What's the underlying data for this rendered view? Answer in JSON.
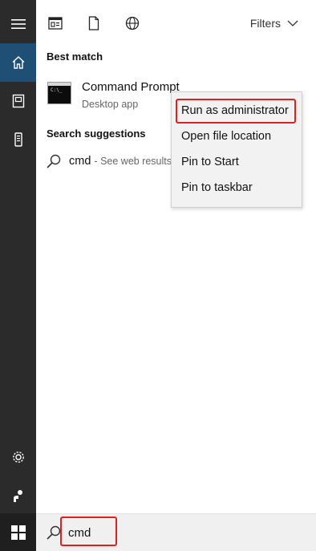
{
  "topbar": {
    "tabs": [
      {
        "icon": "apps-icon"
      },
      {
        "icon": "document-icon"
      },
      {
        "icon": "web-globe-icon"
      }
    ],
    "filters_label": "Filters"
  },
  "sidebar": {
    "items": [
      {
        "icon": "menu-icon"
      },
      {
        "icon": "home-icon",
        "active": true
      },
      {
        "icon": "collection-icon"
      },
      {
        "icon": "device-icon"
      },
      {
        "icon": "settings-gear-icon"
      },
      {
        "icon": "user-feedback-icon"
      }
    ],
    "start_icon": "windows-start-icon"
  },
  "best_match": {
    "heading": "Best match",
    "title": "Command Prompt",
    "subtitle": "Desktop app",
    "icon_text": "C:\\_"
  },
  "suggestions": {
    "heading": "Search suggestions",
    "items": [
      {
        "query": "cmd",
        "hint": "- See web results"
      }
    ]
  },
  "context_menu": {
    "items": [
      {
        "label": "Run as administrator",
        "highlighted": true
      },
      {
        "label": "Open file location"
      },
      {
        "label": "Pin to Start"
      },
      {
        "label": "Pin to taskbar"
      }
    ]
  },
  "search": {
    "value": "cmd"
  },
  "colors": {
    "rail_bg": "#2b2b2b",
    "rail_active": "#1f4f74",
    "highlight_border": "#e02020",
    "menu_bg": "#f2f2f2"
  }
}
